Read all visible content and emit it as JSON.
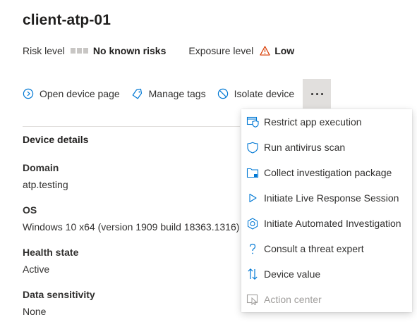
{
  "device": {
    "name": "client-atp-01"
  },
  "risk": {
    "label": "Risk level",
    "value": "No known risks"
  },
  "exposure": {
    "label": "Exposure level",
    "value": "Low"
  },
  "actions": {
    "open_device_page": "Open device page",
    "manage_tags": "Manage tags",
    "isolate_device": "Isolate device"
  },
  "details": {
    "title": "Device details",
    "fields": [
      {
        "label": "Domain",
        "value": "atp.testing"
      },
      {
        "label": "OS",
        "value": "Windows 10 x64 (version 1909 build 18363.1316)"
      },
      {
        "label": "Health state",
        "value": "Active"
      },
      {
        "label": "Data sensitivity",
        "value": "None"
      }
    ]
  },
  "menu": {
    "items": [
      {
        "label": "Restrict app execution",
        "icon": "restrict-app-icon",
        "enabled": true
      },
      {
        "label": "Run antivirus scan",
        "icon": "shield-icon",
        "enabled": true
      },
      {
        "label": "Collect investigation package",
        "icon": "folder-icon",
        "enabled": true
      },
      {
        "label": "Initiate Live Response Session",
        "icon": "play-icon",
        "enabled": true
      },
      {
        "label": "Initiate Automated Investigation",
        "icon": "hexagon-icon",
        "enabled": true
      },
      {
        "label": "Consult a threat expert",
        "icon": "question-icon",
        "enabled": true
      },
      {
        "label": "Device value",
        "icon": "sort-arrows-icon",
        "enabled": true
      },
      {
        "label": "Action center",
        "icon": "action-center-icon",
        "enabled": false
      }
    ]
  },
  "colors": {
    "accent": "#0078d4",
    "warning": "#d83b01",
    "more_button_bg": "#e1dfdd",
    "disabled_text": "#a19f9d"
  }
}
